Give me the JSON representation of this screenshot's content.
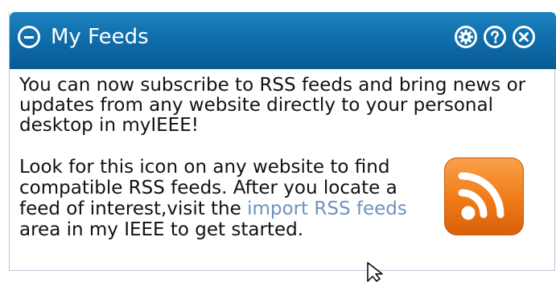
{
  "widget": {
    "title": "My Feeds",
    "header_color": "#0d6aa8",
    "controls": {
      "collapse_icon": "minus-circle-icon",
      "settings_icon": "gear-icon",
      "help_icon": "question-icon",
      "close_icon": "close-icon"
    }
  },
  "content": {
    "intro": "You can now subscribe to RSS feeds and bring news or updates from any website directly to your personal desktop in myIEEE!",
    "look_before_link": "Look for this icon on any website to find compatible RSS feeds. After you locate a feed of interest,visit the ",
    "link_text": "import RSS feeds",
    "look_after_link": " area in my IEEE to get started.",
    "rss_icon": "rss-feed-icon",
    "link_color": "#6e93bf",
    "rss_color": "#f07a17"
  }
}
